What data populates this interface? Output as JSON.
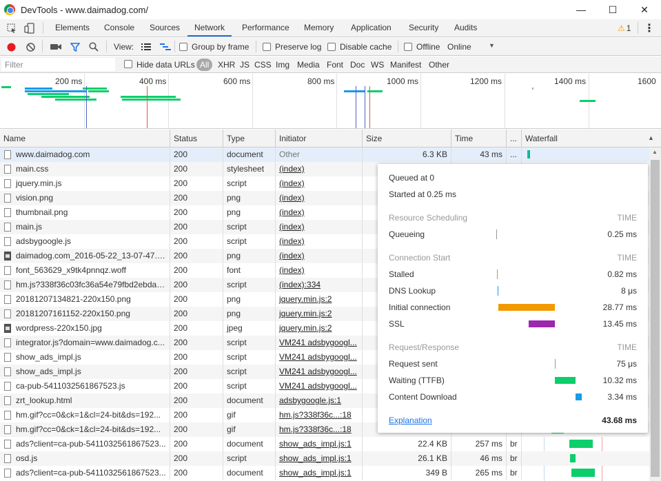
{
  "window": {
    "title": "DevTools - www.daimadog.com/",
    "minimize": "—",
    "maximize": "☐",
    "close": "✕"
  },
  "toolbar": {
    "tabs": [
      "Elements",
      "Console",
      "Sources",
      "Network",
      "Performance",
      "Memory",
      "Application",
      "Security",
      "Audits"
    ],
    "active_tab": "Network",
    "warnings": "1",
    "warning_icon": "⚠",
    "menu_icon": "⋮"
  },
  "net_toolbar": {
    "view_label": "View:",
    "group_by_frame": "Group by frame",
    "preserve_log": "Preserve log",
    "disable_cache": "Disable cache",
    "offline": "Offline",
    "throttle": "Online",
    "record_color": "#e51c23"
  },
  "filter": {
    "placeholder": "Filter",
    "hide_data_urls": "Hide data URLs",
    "types": [
      "All",
      "XHR",
      "JS",
      "CSS",
      "Img",
      "Media",
      "Font",
      "Doc",
      "WS",
      "Manifest",
      "Other"
    ]
  },
  "overview": {
    "ticks": [
      "200 ms",
      "400 ms",
      "600 ms",
      "800 ms",
      "1000 ms",
      "1200 ms",
      "1400 ms",
      "1600"
    ]
  },
  "columns": [
    "Name",
    "Status",
    "Type",
    "Initiator",
    "Size",
    "Time",
    "...",
    "Waterfall"
  ],
  "rows": [
    {
      "name": "www.daimadog.com",
      "status": "200",
      "type": "document",
      "initiator": "Other",
      "size": "6.3 KB",
      "time": "43 ms",
      "extra": "...",
      "icon": "doc"
    },
    {
      "name": "main.css",
      "status": "200",
      "type": "stylesheet",
      "initiator": "(index)",
      "size": "",
      "time": "",
      "extra": "",
      "icon": "doc"
    },
    {
      "name": "jquery.min.js",
      "status": "200",
      "type": "script",
      "initiator": "(index)",
      "size": "",
      "time": "",
      "extra": "",
      "icon": "doc"
    },
    {
      "name": "vision.png",
      "status": "200",
      "type": "png",
      "initiator": "(index)",
      "size": "",
      "time": "",
      "extra": "",
      "icon": "doc"
    },
    {
      "name": "thumbnail.png",
      "status": "200",
      "type": "png",
      "initiator": "(index)",
      "size": "",
      "time": "",
      "extra": "",
      "icon": "doc"
    },
    {
      "name": "main.js",
      "status": "200",
      "type": "script",
      "initiator": "(index)",
      "size": "",
      "time": "",
      "extra": "",
      "icon": "doc"
    },
    {
      "name": "adsbygoogle.js",
      "status": "200",
      "type": "script",
      "initiator": "(index)",
      "size": "",
      "time": "",
      "extra": "",
      "icon": "doc"
    },
    {
      "name": "daimadog.com_2016-05-22_13-07-47.p...",
      "status": "200",
      "type": "png",
      "initiator": "(index)",
      "size": "",
      "time": "",
      "extra": "",
      "icon": "img"
    },
    {
      "name": "font_563629_x9tk4pnnqz.woff",
      "status": "200",
      "type": "font",
      "initiator": "(index)",
      "size": "",
      "time": "",
      "extra": "",
      "icon": "doc"
    },
    {
      "name": "hm.js?338f36c03fc36a54e79fbd2ebdae...",
      "status": "200",
      "type": "script",
      "initiator": "(index):334",
      "size": "",
      "time": "",
      "extra": "",
      "icon": "doc"
    },
    {
      "name": "20181207134821-220x150.png",
      "status": "200",
      "type": "png",
      "initiator": "jquery.min.js:2",
      "size": "",
      "time": "",
      "extra": "",
      "icon": "doc"
    },
    {
      "name": "20181207161152-220x150.png",
      "status": "200",
      "type": "png",
      "initiator": "jquery.min.js:2",
      "size": "",
      "time": "",
      "extra": "",
      "icon": "doc"
    },
    {
      "name": "wordpress-220x150.jpg",
      "status": "200",
      "type": "jpeg",
      "initiator": "jquery.min.js:2",
      "size": "",
      "time": "",
      "extra": "",
      "icon": "img"
    },
    {
      "name": "integrator.js?domain=www.daimadog.c...",
      "status": "200",
      "type": "script",
      "initiator": "VM241 adsbygoogl...",
      "size": "",
      "time": "",
      "extra": "",
      "icon": "doc"
    },
    {
      "name": "show_ads_impl.js",
      "status": "200",
      "type": "script",
      "initiator": "VM241 adsbygoogl...",
      "size": "",
      "time": "",
      "extra": "",
      "icon": "doc"
    },
    {
      "name": "show_ads_impl.js",
      "status": "200",
      "type": "script",
      "initiator": "VM241 adsbygoogl...",
      "size": "",
      "time": "",
      "extra": "",
      "icon": "doc"
    },
    {
      "name": "ca-pub-5411032561867523.js",
      "status": "200",
      "type": "script",
      "initiator": "VM241 adsbygoogl...",
      "size": "",
      "time": "",
      "extra": "",
      "icon": "doc"
    },
    {
      "name": "zrt_lookup.html",
      "status": "200",
      "type": "document",
      "initiator": "adsbygoogle.js:1",
      "size": "",
      "time": "",
      "extra": "",
      "icon": "doc"
    },
    {
      "name": "hm.gif?cc=0&ck=1&cl=24-bit&ds=192...",
      "status": "200",
      "type": "gif",
      "initiator": "hm.js?338f36c...:18",
      "size": "",
      "time": "",
      "extra": "",
      "icon": "doc"
    },
    {
      "name": "hm.gif?cc=0&ck=1&cl=24-bit&ds=192...",
      "status": "200",
      "type": "gif",
      "initiator": "hm.js?338f36c...:18",
      "size": "",
      "time": "",
      "extra": "",
      "icon": "doc"
    },
    {
      "name": "ads?client=ca-pub-5411032561867523...",
      "status": "200",
      "type": "document",
      "initiator": "show_ads_impl.js:1",
      "size": "22.4 KB",
      "time": "257 ms",
      "extra": "br",
      "icon": "doc"
    },
    {
      "name": "osd.js",
      "status": "200",
      "type": "script",
      "initiator": "show_ads_impl.js:1",
      "size": "26.1 KB",
      "time": "46 ms",
      "extra": "br",
      "icon": "doc"
    },
    {
      "name": "ads?client=ca-pub-5411032561867523...",
      "status": "200",
      "type": "document",
      "initiator": "show_ads_impl.js:1",
      "size": "349 B",
      "time": "265 ms",
      "extra": "br",
      "icon": "doc"
    }
  ],
  "timing": {
    "queued": "Queued at 0",
    "started": "Started at 0.25 ms",
    "time_label": "TIME",
    "sections": [
      {
        "title": "Resource Scheduling",
        "items": [
          {
            "label": "Queueing",
            "value": "0.25 ms"
          }
        ]
      },
      {
        "title": "Connection Start",
        "items": [
          {
            "label": "Stalled",
            "value": "0.82 ms"
          },
          {
            "label": "DNS Lookup",
            "value": "8 μs"
          },
          {
            "label": "Initial connection",
            "value": "28.77 ms"
          },
          {
            "label": "SSL",
            "value": "13.45 ms"
          }
        ]
      },
      {
        "title": "Request/Response",
        "items": [
          {
            "label": "Request sent",
            "value": "75 μs"
          },
          {
            "label": "Waiting (TTFB)",
            "value": "10.32 ms"
          },
          {
            "label": "Content Download",
            "value": "3.34 ms"
          }
        ]
      }
    ],
    "explanation": "Explanation",
    "total": "43.68 ms",
    "colors": {
      "connection": "#f29900",
      "ssl": "#9c27b0",
      "waiting": "#0cce6b",
      "download": "#1a9be8",
      "queue": "#999999"
    }
  }
}
